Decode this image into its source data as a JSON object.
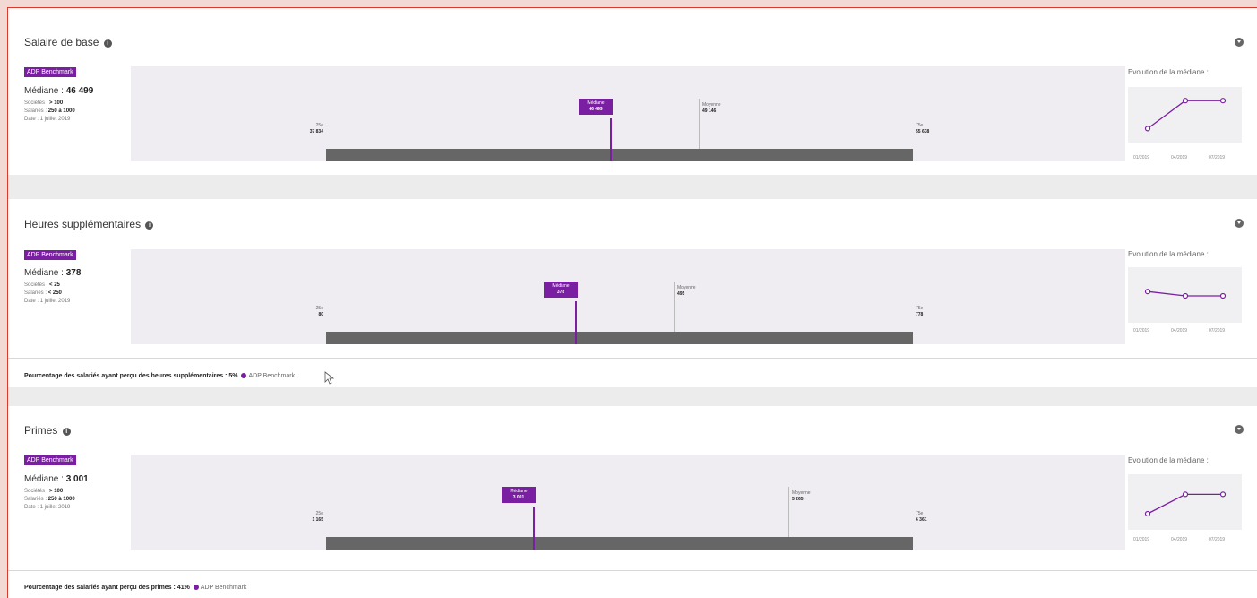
{
  "sections": [
    {
      "title": "Salaire de base",
      "badge": "ADP Benchmark",
      "median_label": "Médiane :",
      "median_value": "46 499",
      "meta": [
        {
          "label": "Sociétés :",
          "value": "> 100"
        },
        {
          "label": "Salariés :",
          "value": "250 à 1000"
        },
        {
          "label": "Date :",
          "value": "1 juillet 2019"
        }
      ],
      "p25_label": "25e",
      "p25_value": "37 834",
      "p75_label": "75e",
      "p75_value": "55 638",
      "median_marker_label": "Médiane",
      "median_marker_value": "46 499",
      "mean_label": "Moyenne",
      "mean_value": "49 146",
      "evolution_title": "Evolution de la médiane :",
      "evolution_x": [
        "01/2019",
        "04/2019",
        "07/2019"
      ],
      "evolution_levels": [
        0.2,
        0.85,
        0.85
      ]
    },
    {
      "title": "Heures supplémentaires",
      "badge": "ADP Benchmark",
      "median_label": "Médiane :",
      "median_value": "378",
      "meta": [
        {
          "label": "Sociétés :",
          "value": "< 25"
        },
        {
          "label": "Salariés :",
          "value": "< 250"
        },
        {
          "label": "Date :",
          "value": "1 juillet 2019"
        }
      ],
      "p25_label": "25e",
      "p25_value": "80",
      "p75_label": "75e",
      "p75_value": "778",
      "median_marker_label": "Médiane",
      "median_marker_value": "378",
      "mean_label": "Moyenne",
      "mean_value": "495",
      "evolution_title": "Evolution de la médiane :",
      "evolution_x": [
        "01/2019",
        "04/2019",
        "07/2019"
      ],
      "evolution_levels": [
        0.6,
        0.5,
        0.5
      ],
      "footer_text": "Pourcentage des salariés ayant perçu des heures supplémentaires :",
      "footer_value": "5%",
      "footer_source": "ADP Benchmark"
    },
    {
      "title": "Primes",
      "badge": "ADP Benchmark",
      "median_label": "Médiane :",
      "median_value": "3 001",
      "meta": [
        {
          "label": "Sociétés :",
          "value": "> 100"
        },
        {
          "label": "Salariés :",
          "value": "250 à 1000"
        },
        {
          "label": "Date :",
          "value": "1 juillet 2019"
        }
      ],
      "p25_label": "25e",
      "p25_value": "1 165",
      "p75_label": "75e",
      "p75_value": "6 361",
      "median_marker_label": "Médiane",
      "median_marker_value": "3 001",
      "mean_label": "Moyenne",
      "mean_value": "5 265",
      "evolution_title": "Evolution de la médiane :",
      "evolution_x": [
        "01/2019",
        "04/2019",
        "07/2019"
      ],
      "evolution_levels": [
        0.25,
        0.7,
        0.7
      ],
      "footer_text": "Pourcentage des salariés ayant perçu des primes :",
      "footer_value": "41%",
      "footer_source": "ADP Benchmark"
    }
  ],
  "colors": {
    "accent": "#7b1fa2",
    "track": "#666666",
    "chart_bg": "#efecf2"
  }
}
